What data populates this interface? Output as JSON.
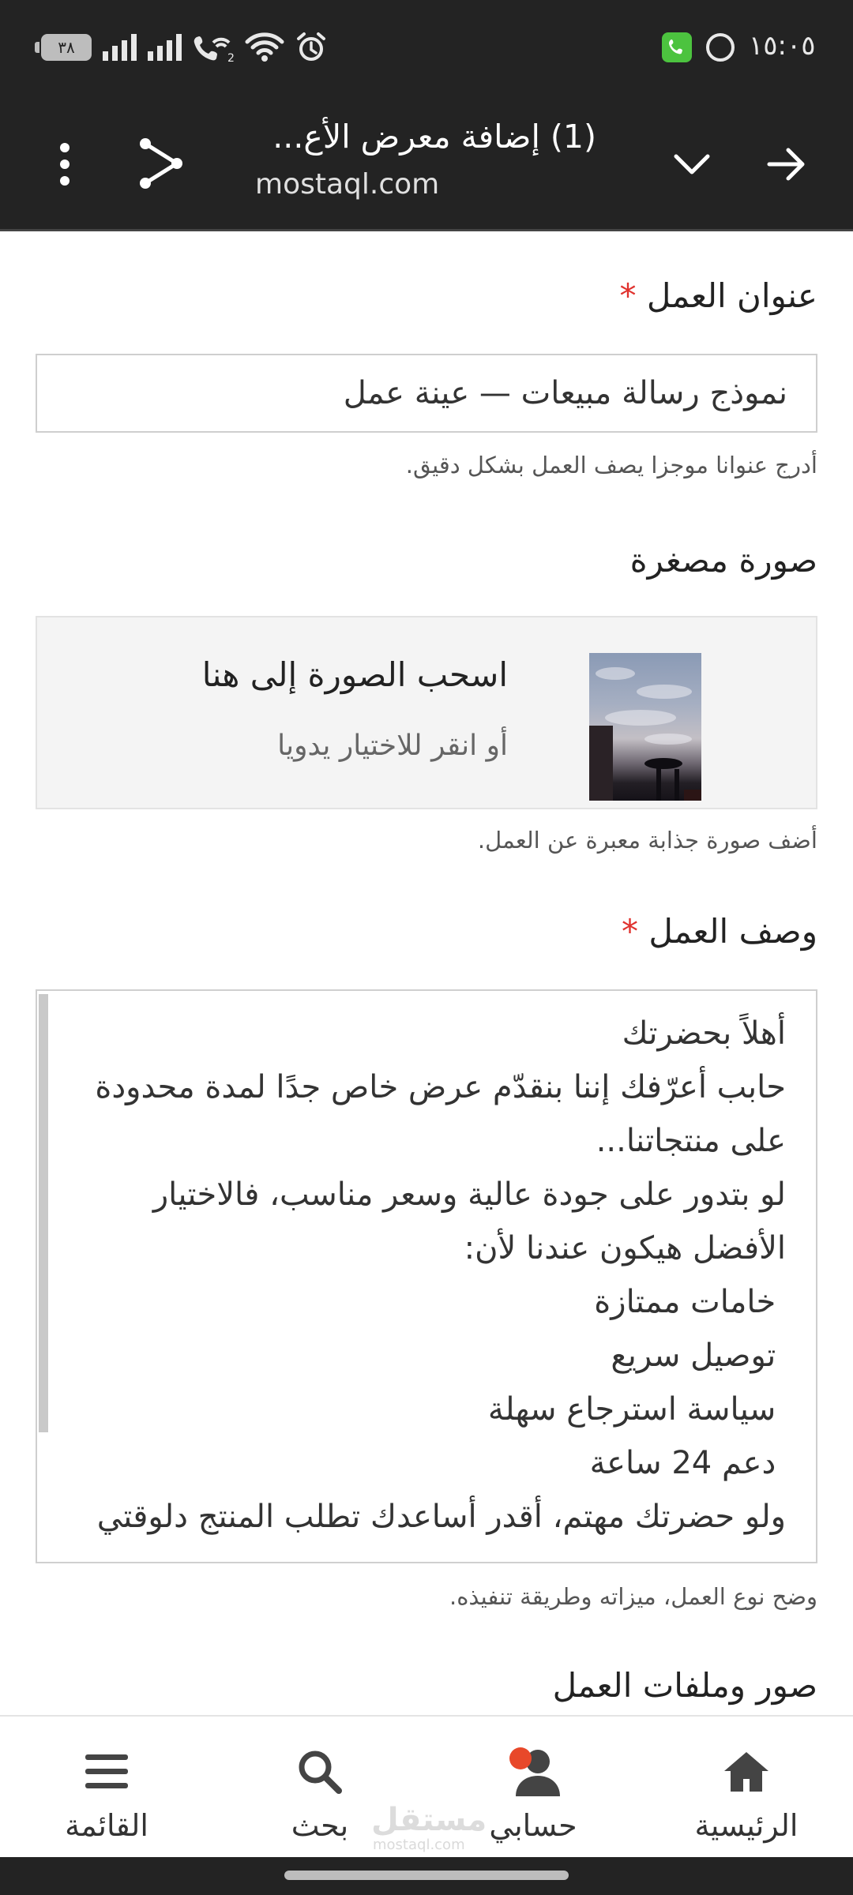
{
  "status_bar": {
    "time": "١٥:٠٥",
    "battery_level": "٣٨",
    "icons": [
      "phone-app-icon",
      "whatsapp-icon",
      "alarm-icon",
      "wifi-icon",
      "wifi-calling-icon",
      "signal-icon",
      "signal-icon",
      "battery-icon"
    ]
  },
  "browser": {
    "tab_title": "(1) إضافة معرض الأع...",
    "url": "mostaql.com"
  },
  "form": {
    "work_title": {
      "label": "عنوان العمل",
      "required_mark": "*",
      "value": "نموذج رسالة مبيعات — عينة عمل",
      "hint": "أدرج عنوانا موجزا يصف العمل بشكل دقيق."
    },
    "thumbnail": {
      "label": "صورة مصغرة",
      "drop_title": "اسحب الصورة إلى هنا",
      "drop_subtitle": "أو انقر للاختيار يدويا",
      "hint": "أضف صورة جذابة معبرة عن العمل."
    },
    "description": {
      "label": "وصف العمل",
      "required_mark": "*",
      "value": "أهلاً بحضرتك\nحابب أعرّفك إننا بنقدّم عرض خاص جدًا لمدة محدودة على منتجاتنا...\nلو بتدور على جودة عالية وسعر مناسب، فالاختيار الأفضل هيكون عندنا لأن:\n خامات ممتازة\n توصيل سريع\n سياسة استرجاع سهلة\n دعم 24 ساعة\nولو حضرتك مهتم، أقدر أساعدك تطلب المنتج دلوقتي",
      "hint": "وضح نوع العمل، ميزاته وطريقة تنفيذه."
    },
    "files_section_label": "صور وملفات العمل"
  },
  "bottom_nav": {
    "items": [
      {
        "label": "الرئيسية",
        "icon": "home-icon"
      },
      {
        "label": "حسابي",
        "icon": "account-icon"
      },
      {
        "label": "بحث",
        "icon": "search-icon"
      },
      {
        "label": "القائمة",
        "icon": "menu-icon"
      }
    ]
  },
  "watermark": {
    "text": "مستقل",
    "sub": "mostaql.com"
  },
  "colors": {
    "bar_background": "#232323",
    "required": "#e0322e",
    "notification_dot": "#e8482a"
  }
}
